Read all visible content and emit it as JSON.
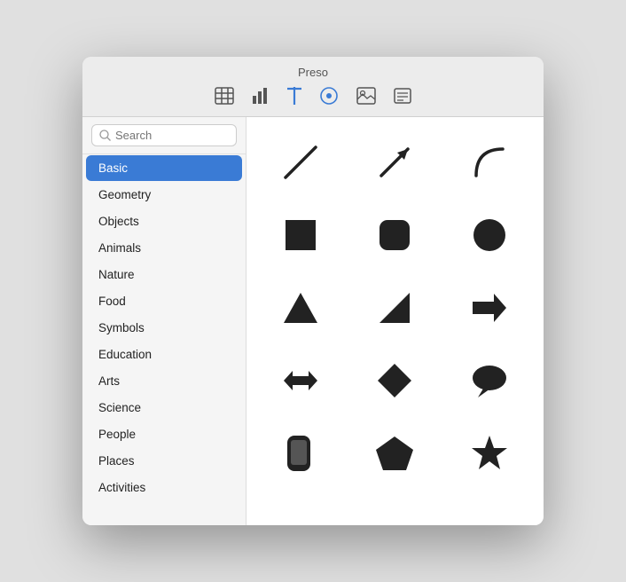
{
  "window": {
    "title": "Preso"
  },
  "toolbar": {
    "title": "Preso",
    "icons": [
      {
        "name": "table-icon",
        "symbol": "⊞",
        "label": "Table"
      },
      {
        "name": "chart-icon",
        "symbol": "📊",
        "label": "Chart"
      },
      {
        "name": "text-icon",
        "symbol": "T",
        "label": "Text"
      },
      {
        "name": "shapes-icon",
        "symbol": "⬡",
        "label": "Shapes"
      },
      {
        "name": "media-icon",
        "symbol": "🖼",
        "label": "Media"
      },
      {
        "name": "comment-icon",
        "symbol": "☰",
        "label": "Comment"
      }
    ]
  },
  "search": {
    "placeholder": "Search"
  },
  "categories": [
    {
      "id": "basic",
      "label": "Basic",
      "selected": true
    },
    {
      "id": "geometry",
      "label": "Geometry",
      "selected": false
    },
    {
      "id": "objects",
      "label": "Objects",
      "selected": false
    },
    {
      "id": "animals",
      "label": "Animals",
      "selected": false
    },
    {
      "id": "nature",
      "label": "Nature",
      "selected": false
    },
    {
      "id": "food",
      "label": "Food",
      "selected": false
    },
    {
      "id": "symbols",
      "label": "Symbols",
      "selected": false
    },
    {
      "id": "education",
      "label": "Education",
      "selected": false
    },
    {
      "id": "arts",
      "label": "Arts",
      "selected": false
    },
    {
      "id": "science",
      "label": "Science",
      "selected": false
    },
    {
      "id": "people",
      "label": "People",
      "selected": false
    },
    {
      "id": "places",
      "label": "Places",
      "selected": false
    },
    {
      "id": "activities",
      "label": "Activities",
      "selected": false
    }
  ],
  "shapes": [
    {
      "name": "diagonal-line",
      "type": "line"
    },
    {
      "name": "arrow-diagonal",
      "type": "arrow"
    },
    {
      "name": "arc",
      "type": "arc"
    },
    {
      "name": "square",
      "type": "square"
    },
    {
      "name": "rounded-square",
      "type": "rounded-square"
    },
    {
      "name": "circle",
      "type": "circle"
    },
    {
      "name": "triangle",
      "type": "triangle"
    },
    {
      "name": "right-triangle",
      "type": "right-triangle"
    },
    {
      "name": "arrow-right",
      "type": "arrow-right"
    },
    {
      "name": "arrow-left-right",
      "type": "arrow-left-right"
    },
    {
      "name": "diamond",
      "type": "diamond"
    },
    {
      "name": "speech-bubble",
      "type": "speech-bubble"
    },
    {
      "name": "phone",
      "type": "phone"
    },
    {
      "name": "pentagon",
      "type": "pentagon"
    },
    {
      "name": "star",
      "type": "star"
    }
  ]
}
